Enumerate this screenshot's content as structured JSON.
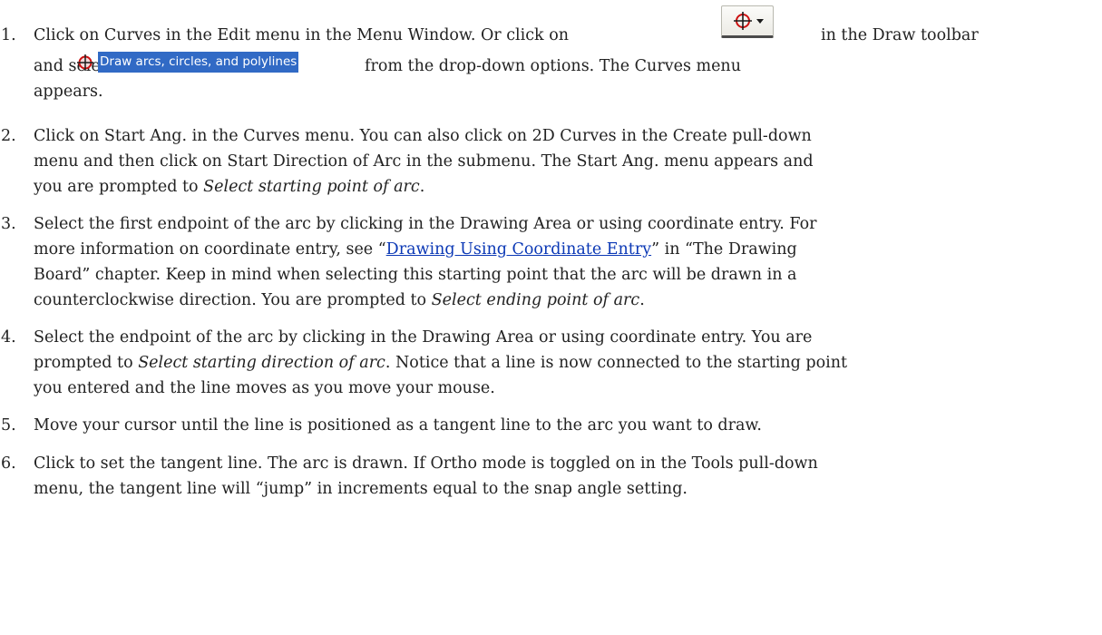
{
  "steps": [
    {
      "number": "1.",
      "parts": {
        "a": "Click on Curves in the Edit menu in the Menu Window. Or click on",
        "b": "in the Draw toolbar",
        "c": "and select",
        "d": "from the drop-down options. The Curves menu",
        "e": "appears."
      },
      "menu_item_label": "Draw arcs, circles, and polylines",
      "toolbar_icon": "curves-dropdown-icon"
    },
    {
      "number": "2.",
      "lines": [
        "Click on Start Ang. in the Curves menu. You can also click on 2D Curves in the Create pull-down",
        "menu and then click on Start Direction of Arc in the submenu. The Start Ang. menu appears and"
      ],
      "line3_prefix": "you are prompted to ",
      "line3_italic": "Select starting point of arc",
      "line3_suffix": "."
    },
    {
      "number": "3.",
      "line1": "Select the first endpoint of the arc by clicking in the Drawing Area or using coordinate entry. For",
      "line2_prefix": "more information on coordinate entry, see “",
      "line2_link": "Drawing Using Coordinate Entry",
      "line2_suffix": "” in “The Drawing",
      "line3": "Board” chapter. Keep in mind when selecting this starting point that the arc will be drawn in a",
      "line4_prefix": "counterclockwise direction. You are prompted to ",
      "line4_italic": "Select ending point of arc",
      "line4_suffix": "."
    },
    {
      "number": "4.",
      "line1": "Select the endpoint of the arc by clicking in the Drawing Area or using coordinate entry. You are",
      "line2_prefix": "prompted to ",
      "line2_italic": "Select starting direction of arc",
      "line2_suffix": ". Notice that a line is now connected to the starting point",
      "line3": "you entered and the line moves as you move your mouse."
    },
    {
      "number": "5.",
      "line1": "Move your cursor until the line is positioned as a tangent line to the arc you want to draw."
    },
    {
      "number": "6.",
      "line1": "Click to set the tangent line. The arc is drawn. If Ortho mode is toggled on in the Tools pull-down",
      "line2": "menu, the tangent line will “jump” in increments equal to the snap angle setting."
    }
  ],
  "colors": {
    "text": "#222222",
    "link": "#0b38b5",
    "highlight": "#316ac5",
    "icon_red": "#cc1111"
  }
}
